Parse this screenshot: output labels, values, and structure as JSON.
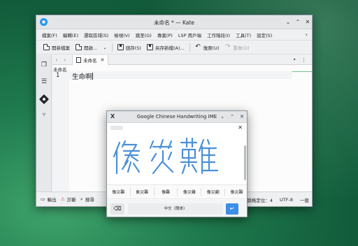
{
  "window": {
    "title": "未命名 * — Kate",
    "controls": {
      "minimize": "⌄",
      "maximize": "⌃",
      "close": "✕"
    }
  },
  "menubar": {
    "items": [
      "檔案(F)",
      "編輯(E)",
      "選取區域(S)",
      "檢視(V)",
      "跳至(G)",
      "專案(P)",
      "LSP 用戶端",
      "工作階段(I)",
      "工具(T)",
      "設定(S)"
    ],
    "more": "›"
  },
  "toolbar": {
    "new": "開新檔案",
    "open": "開啟...",
    "open_menu": "⌄",
    "save": "儲存(S)",
    "save_as": "另存新檔(A)...",
    "undo": "復原(U)",
    "redo": "重做(D)"
  },
  "tabs": {
    "back": "‹",
    "forward": "›",
    "active_label": "未命名",
    "close": "✕",
    "pin": "⭑",
    "menu": "⋮"
  },
  "editor": {
    "doc_label": "未命名",
    "line_number": "1",
    "line_text": "生命啊"
  },
  "statusbar": {
    "output": "輸出",
    "diagnostics": "診斷",
    "search": "搜尋",
    "tab_setting": "軟跳格定位：4",
    "encoding": "UTF-8",
    "line_ending": "一般"
  },
  "ime": {
    "title": "Google Chinese Handwriting IME",
    "logo": "X",
    "controls": {
      "minimize": "⌄",
      "maximize": "⌃",
      "close": "✕"
    },
    "ink_close": "✕",
    "handwriting_color": "#4a90d9",
    "candidates": [
      "像災難",
      "象災難",
      "像難",
      "像災雞",
      "像災翻",
      "像災難"
    ],
    "delete": "⌫",
    "space_label": "中文（簡体）",
    "enter": "↵"
  },
  "colors": {
    "accent": "#1d99f3",
    "enter_key": "#3d8ee6",
    "warning": "#da4453",
    "minimap": "#6fc38e"
  }
}
